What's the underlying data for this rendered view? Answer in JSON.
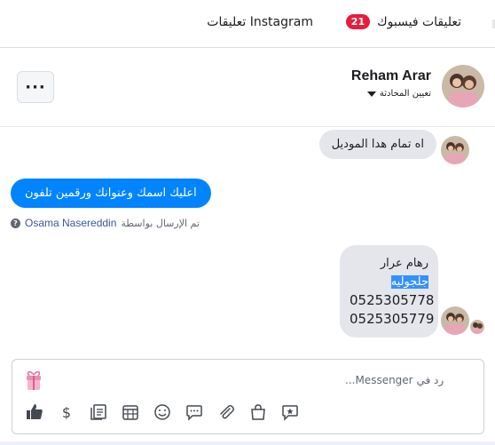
{
  "tabs": {
    "facebook_label": "تعليقات فيسبوك",
    "facebook_count": "21",
    "instagram_label": "تعليقات Instagram"
  },
  "header": {
    "contact_name": "Reham Arar",
    "assign_label": "تعيين المحادثة",
    "more_label": "···"
  },
  "messages": [
    {
      "direction": "incoming",
      "text": "اه تمام هدا الموديل"
    },
    {
      "direction": "outgoing",
      "text": "اعليك اسمك وعنوانك ورقمين تلفون"
    },
    {
      "direction": "incoming",
      "lines": [
        "رهام عرار",
        "جلجوليه",
        "0525305778",
        "0525305779"
      ]
    }
  ],
  "sent_by": {
    "prefix": "تم الإرسال بواسطة",
    "name": "Osama Nasereddin"
  },
  "composer": {
    "placeholder": "رد في Messenger...",
    "tools": [
      "thumbs-up-icon",
      "dollar-icon",
      "saved-replies-icon",
      "appointment-icon",
      "emoji-icon",
      "chat-bubble-icon",
      "attachment-icon",
      "shop-bag-icon",
      "sticker-star-icon"
    ]
  },
  "colors": {
    "accent": "#0084ff",
    "badge": "#e41e3f",
    "incoming_bubble": "#e4e6eb",
    "selection": "#3390ff"
  }
}
